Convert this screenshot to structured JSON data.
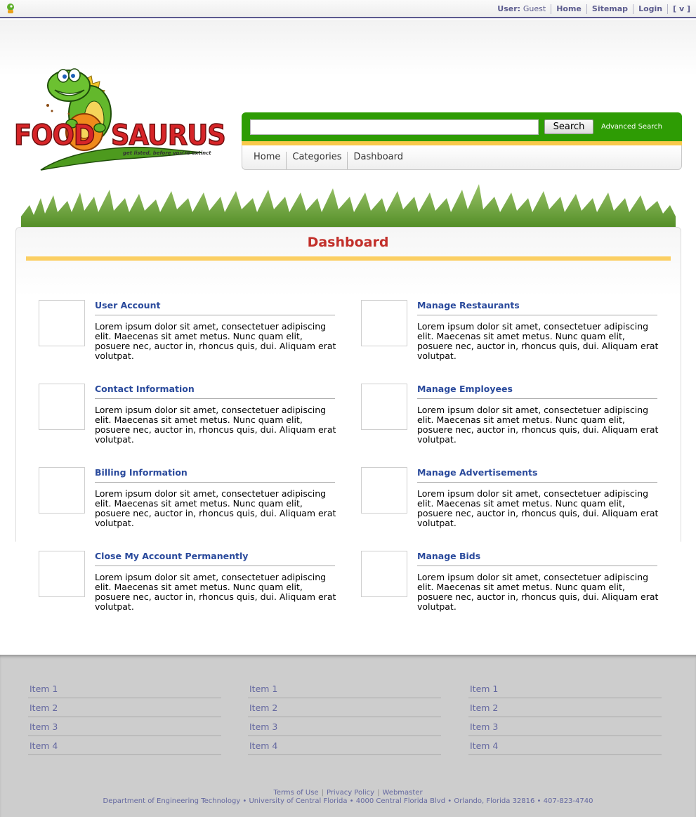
{
  "topbar": {
    "user_label": "User:",
    "user_value": "Guest",
    "links": [
      "Home",
      "Sitemap",
      "Login",
      "[ v ]"
    ]
  },
  "logo": {
    "wordmark": "FOOD-O-SAURUS",
    "tagline": "get listed, before you're extinct"
  },
  "search": {
    "input_value": "",
    "button_label": "Search",
    "advanced_label": "Advanced Search"
  },
  "nav": {
    "items": [
      "Home",
      "Categories",
      "Dashboard"
    ]
  },
  "page": {
    "title": "Dashboard"
  },
  "dashboard": {
    "items": [
      {
        "title": "User Account",
        "desc": "Lorem ipsum dolor sit amet, consectetuer adipiscing elit. Maecenas sit amet metus. Nunc quam elit, posuere nec, auctor in, rhoncus quis, dui. Aliquam erat volutpat."
      },
      {
        "title": "Manage Restaurants",
        "desc": "Lorem ipsum dolor sit amet, consectetuer adipiscing elit. Maecenas sit amet metus. Nunc quam elit, posuere nec, auctor in, rhoncus quis, dui. Aliquam erat volutpat."
      },
      {
        "title": "Contact Information",
        "desc": "Lorem ipsum dolor sit amet, consectetuer adipiscing elit. Maecenas sit amet metus. Nunc quam elit, posuere nec, auctor in, rhoncus quis, dui. Aliquam erat volutpat."
      },
      {
        "title": "Manage Employees",
        "desc": "Lorem ipsum dolor sit amet, consectetuer adipiscing elit. Maecenas sit amet metus. Nunc quam elit, posuere nec, auctor in, rhoncus quis, dui. Aliquam erat volutpat."
      },
      {
        "title": "Billing Information",
        "desc": "Lorem ipsum dolor sit amet, consectetuer adipiscing elit. Maecenas sit amet metus. Nunc quam elit, posuere nec, auctor in, rhoncus quis, dui. Aliquam erat volutpat."
      },
      {
        "title": "Manage Advertisements",
        "desc": "Lorem ipsum dolor sit amet, consectetuer adipiscing elit. Maecenas sit amet metus. Nunc quam elit, posuere nec, auctor in, rhoncus quis, dui. Aliquam erat volutpat."
      },
      {
        "title": "Close My Account Permanently",
        "desc": "Lorem ipsum dolor sit amet, consectetuer adipiscing elit. Maecenas sit amet metus. Nunc quam elit, posuere nec, auctor in, rhoncus quis, dui. Aliquam erat volutpat."
      },
      {
        "title": "Manage Bids",
        "desc": "Lorem ipsum dolor sit amet, consectetuer adipiscing elit. Maecenas sit amet metus. Nunc quam elit, posuere nec, auctor in, rhoncus quis, dui. Aliquam erat volutpat."
      }
    ]
  },
  "footer": {
    "columns": [
      [
        "Item 1",
        "Item 2",
        "Item 3",
        "Item 4"
      ],
      [
        "Item 1",
        "Item 2",
        "Item 3",
        "Item 4"
      ],
      [
        "Item 1",
        "Item 2",
        "Item 3",
        "Item 4"
      ]
    ],
    "links": [
      "Terms of Use",
      "Privacy Policy",
      "Webmaster"
    ],
    "address": "Department of Engineering Technology • University of Central Florida • 4000 Central Florida Blvd • Orlando, Florida 32816 • 407-823-4740"
  },
  "colors": {
    "brand_green": "#2e9c04",
    "accent_yellow": "#f9c94a",
    "title_red": "#c2302b",
    "link_blue": "#2a4a9c"
  }
}
